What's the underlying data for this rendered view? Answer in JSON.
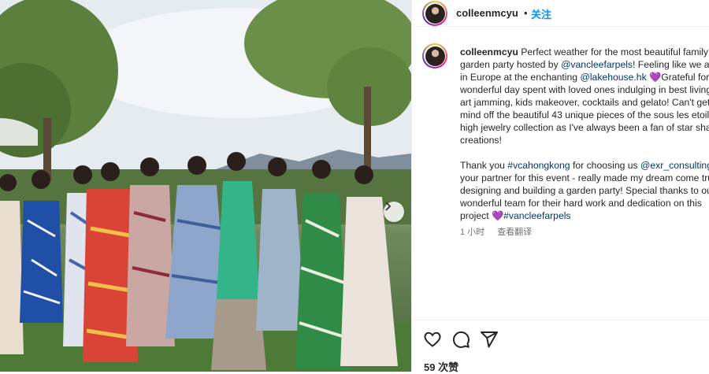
{
  "post": {
    "username": "colleenmcyu",
    "separator": "•",
    "follow_label": "关注"
  },
  "caption": {
    "username": "colleenmcyu",
    "p1_a": "Perfect weather for the most beautiful family garden party hosted by ",
    "mention_vca": "@vancleefarpels",
    "p1_b": "! Feeling like we are in Europe at the enchanting ",
    "mention_lake": "@lakehouse.hk",
    "emoji1": "💜",
    "p1_c": "Grateful for a wonderful day spent with loved ones indulging in best living, art jamming, kids makeover, cocktails and gelato! Can't get my mind off the beautiful 43 unique pieces of the sous les etoiles high jewelry collection as I've always been a fan of star shaped creations!",
    "p2_a": "Thank you ",
    "hashtag_vcahk": "#vcahongkong",
    "p2_b": " for choosing us ",
    "mention_exr": "@exr_consulting",
    "p2_c": " as your partner for this event - really made my dream come true designing and building a garden party! Special thanks to our wonderful team for their hard work and dedication on this project ",
    "emoji2": "💜",
    "hashtag_vca": "#vancleefarpels"
  },
  "meta": {
    "time": "1 小时",
    "translate": "查看翻译"
  },
  "likes": "59 次赞",
  "icons": [
    "heart-icon",
    "comment-icon",
    "share-icon",
    "chevron-right-icon"
  ]
}
